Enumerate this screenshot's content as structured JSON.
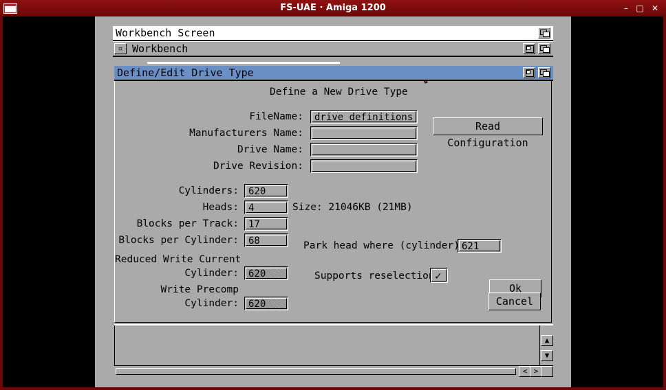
{
  "host": {
    "title": "FS-UAE · Amiga 1200",
    "minimize": "–",
    "maximize": "□",
    "close": "✕"
  },
  "workbench_screen": {
    "title": "Workbench Screen"
  },
  "workbench_window": {
    "close_glyph": "▫",
    "title": "Workbench"
  },
  "dialog": {
    "title": "Define/Edit Drive Type",
    "heading": "Define a New Drive Type",
    "filename_label": "FileName:",
    "filename_value": "drive definitions",
    "manufacturer_label": "Manufacturers Name:",
    "manufacturer_value": "",
    "drive_name_label": "Drive Name:",
    "drive_name_value": "",
    "drive_revision_label": "Drive Revision:",
    "drive_revision_value": "",
    "read_config_label": "Read Configuration",
    "cylinders_label": "Cylinders:",
    "cylinders_value": "620",
    "heads_label": "Heads:",
    "heads_value": "4",
    "size_text": "Size: 21046KB (21MB)",
    "blocks_track_label": "Blocks per Track:",
    "blocks_track_value": "17",
    "blocks_cyl_label": "Blocks per Cylinder:",
    "blocks_cyl_value": "68",
    "park_label": "Park head where (cylinder):",
    "park_value": "621",
    "reduced_write_label1": "Reduced Write Current",
    "reduced_write_label2": "Cylinder:",
    "reduced_write_value": "620",
    "supports_label": "Supports reselection",
    "supports_check": "✓",
    "write_precomp_label1": "Write Precomp",
    "write_precomp_label2": "Cylinder:",
    "write_precomp_value": "620",
    "ok_label": "Ok",
    "cancel_label": "Cancel"
  },
  "scrollbar": {
    "up": "▲",
    "down": "▼",
    "left": "<",
    "right": ">"
  }
}
